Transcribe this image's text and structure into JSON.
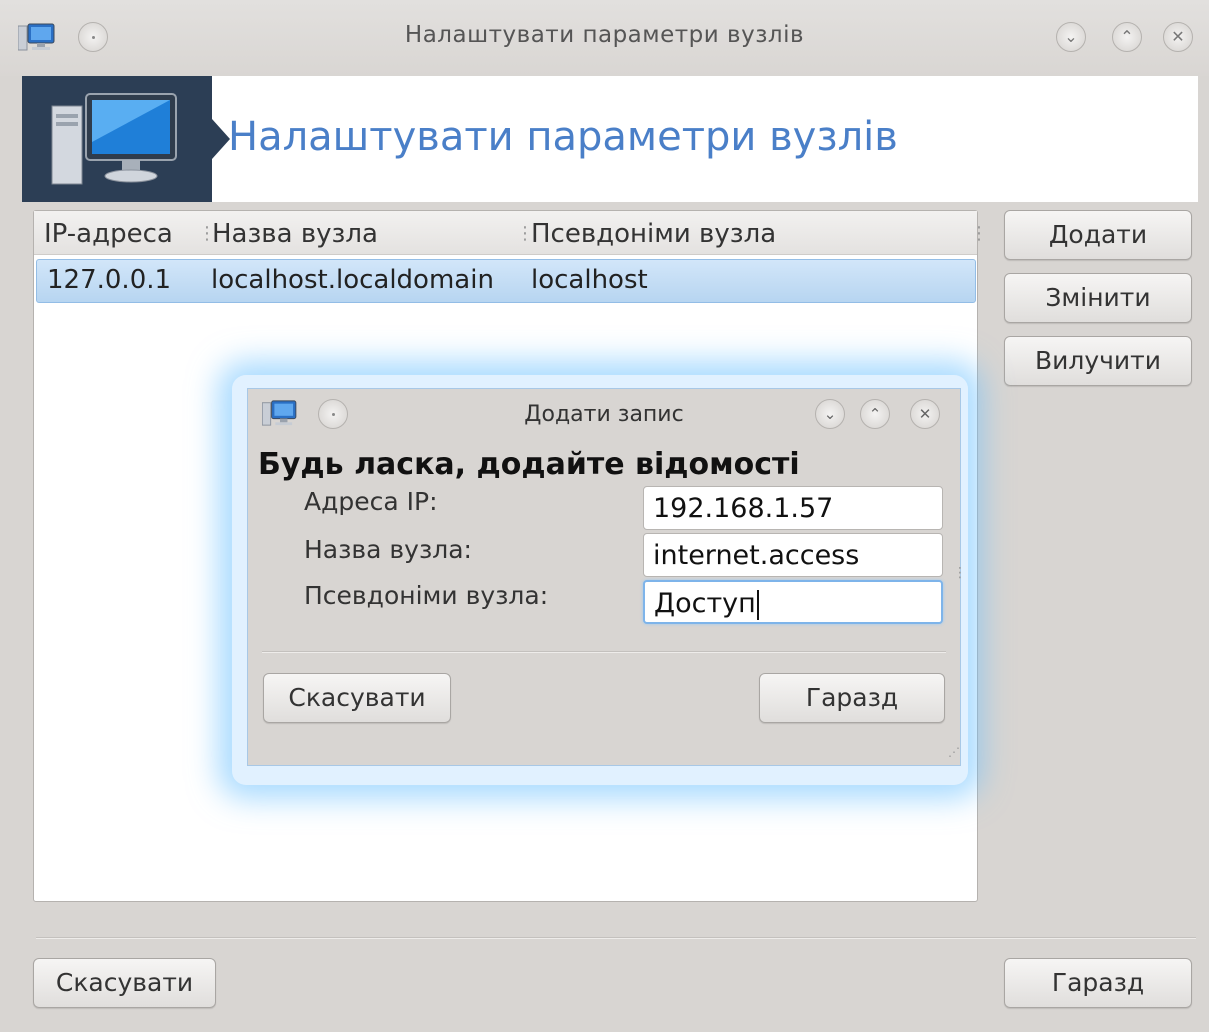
{
  "window": {
    "title": "Налаштувати параметри вузлів",
    "controls": {
      "minimize": "⌄",
      "maximize": "⌃",
      "close": "✕"
    }
  },
  "banner": {
    "title": "Налаштувати параметри вузлів",
    "icon": "computer-icon"
  },
  "list": {
    "columns": [
      "IP-адреса",
      "Назва вузла",
      "Псевдоніми вузла"
    ],
    "rows": [
      {
        "ip": "127.0.0.1",
        "host": "localhost.localdomain",
        "alias": "localhost"
      }
    ]
  },
  "side_buttons": {
    "add": "Додати",
    "edit": "Змінити",
    "remove": "Вилучити"
  },
  "footer": {
    "cancel": "Скасувати",
    "ok": "Гаразд"
  },
  "dialog": {
    "title": "Додати запис",
    "heading": "Будь ласка, додайте відомості",
    "fields": {
      "ip_label": "Адреса IP:",
      "ip_value": "192.168.1.57",
      "host_label": "Назва вузла:",
      "host_value": "internet.access",
      "alias_label": "Псевдоніми вузла:",
      "alias_value": "Доступ"
    },
    "cancel": "Скасувати",
    "ok": "Гаразд"
  },
  "colors": {
    "banner_title": "#4a7fc8",
    "banner_icon_bg": "#2c3e55",
    "selection": "#b7d5f1",
    "focus_glow": "#64beff"
  }
}
